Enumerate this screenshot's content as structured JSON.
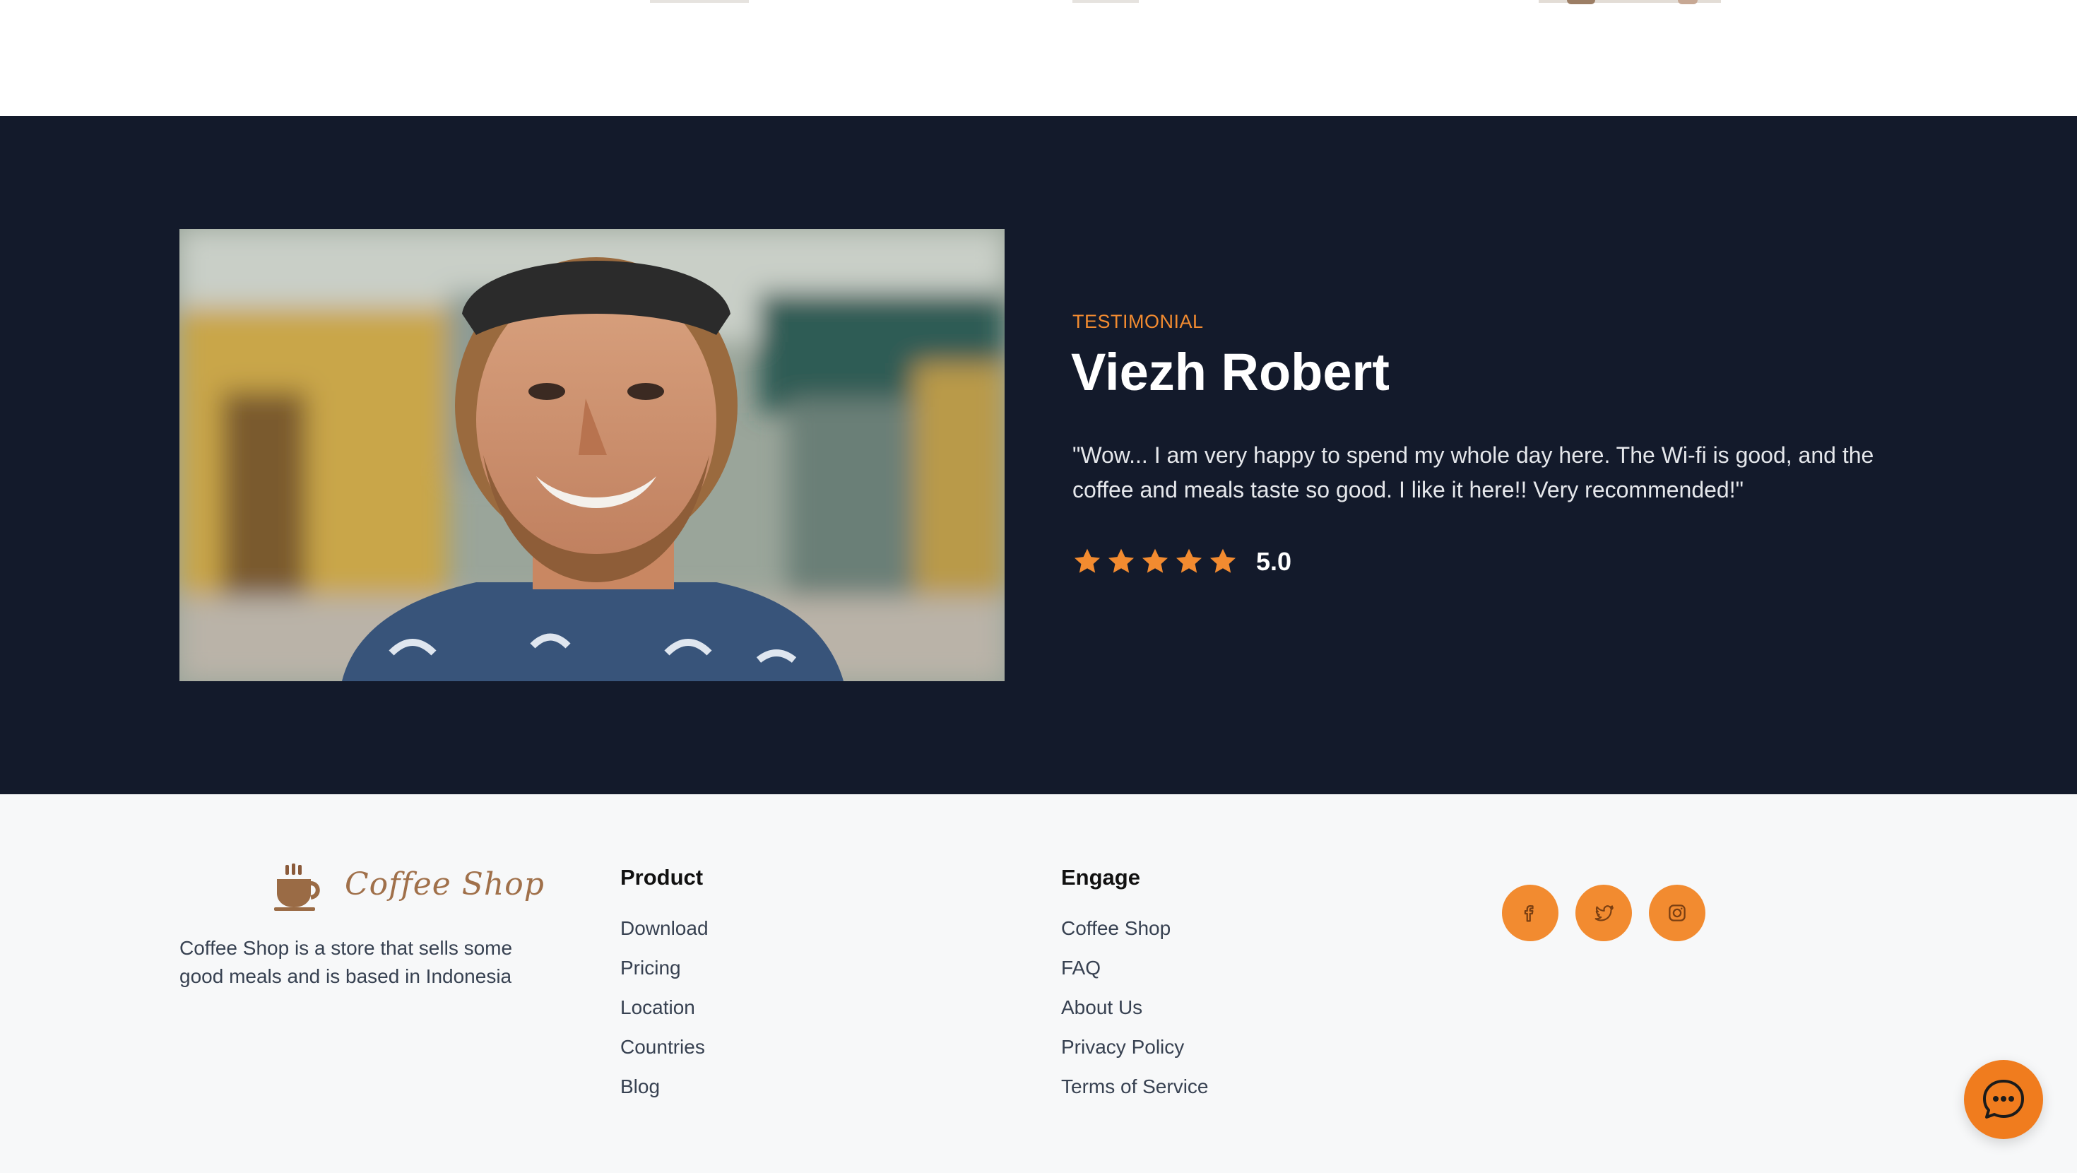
{
  "testimonial": {
    "eyebrow": "TESTIMONIAL",
    "name": "Viezh Robert",
    "quote": "\"Wow... I am very happy to spend my whole day here. The Wi-fi is good, and the coffee and meals taste so good. I like it here!! Very recommended!\"",
    "rating": 5,
    "rating_text": "5.0",
    "photo": "smiling-man-portrait"
  },
  "footer": {
    "brand": {
      "name": "Coffee Shop",
      "icon": "coffee-cup-icon",
      "description": "Coffee Shop is a store that sells some good meals and is based in Indonesia"
    },
    "product": {
      "title": "Product",
      "links": [
        "Download",
        "Pricing",
        "Location",
        "Countries",
        "Blog"
      ]
    },
    "engage": {
      "title": "Engage",
      "links": [
        "Coffee Shop",
        "FAQ",
        "About Us",
        "Privacy Policy",
        "Terms of Service"
      ]
    },
    "socials": [
      "facebook-icon",
      "twitter-icon",
      "instagram-icon"
    ]
  },
  "chat": {
    "icon": "chat-bubble-icon"
  },
  "colors": {
    "accent": "#f28b30",
    "dark_bg": "#131a2b",
    "footer_bg": "#f7f8f9",
    "chat": "#f07c1e",
    "brand": "#a0704a"
  }
}
